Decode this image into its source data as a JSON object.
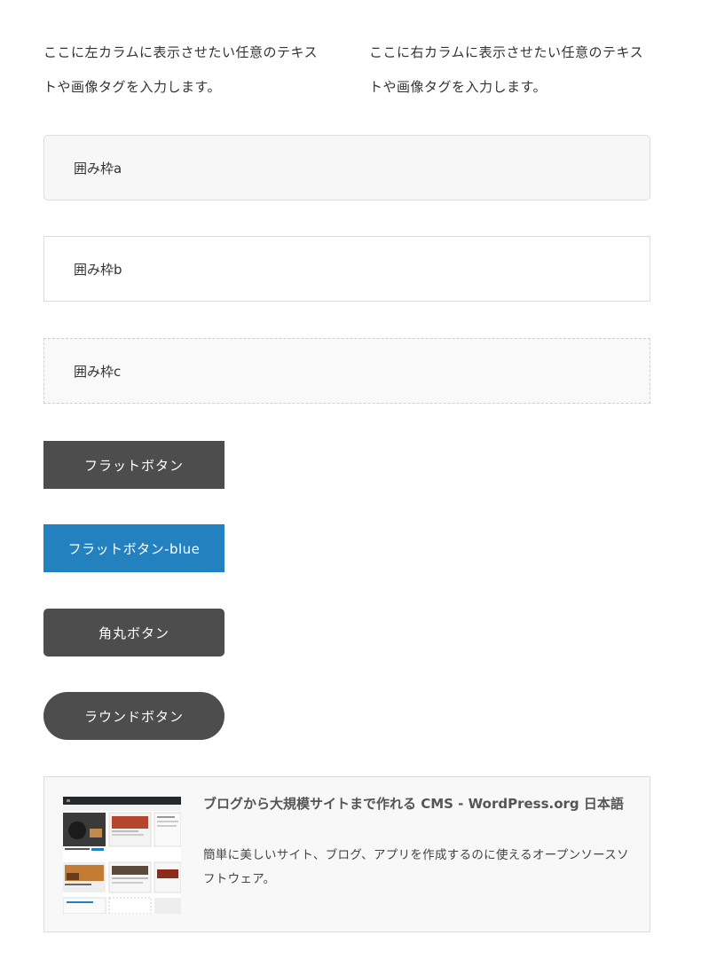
{
  "columns": {
    "left": "ここに左カラムに表示させたい任意のテキストや画像タグを入力します。",
    "right": "ここに右カラムに表示させたい任意のテキストや画像タグを入力します。"
  },
  "boxes": {
    "a": "囲み枠a",
    "b": "囲み枠b",
    "c": "囲み枠c"
  },
  "buttons": {
    "flat": "フラットボタン",
    "flat_blue": "フラットボタン-blue",
    "rounded": "角丸ボタン",
    "round": "ラウンドボタン"
  },
  "link_card": {
    "title": "ブログから大規模サイトまで作れる CMS - WordPress.org 日本語",
    "description": "簡単に美しいサイト、ブログ、アプリを作成するのに使えるオープンソースソフトウェア。"
  },
  "colors": {
    "button_dark": "#4d4d4d",
    "button_blue": "#2481bf",
    "box_a_bg": "#f7f7f7",
    "border": "#dddddd"
  }
}
